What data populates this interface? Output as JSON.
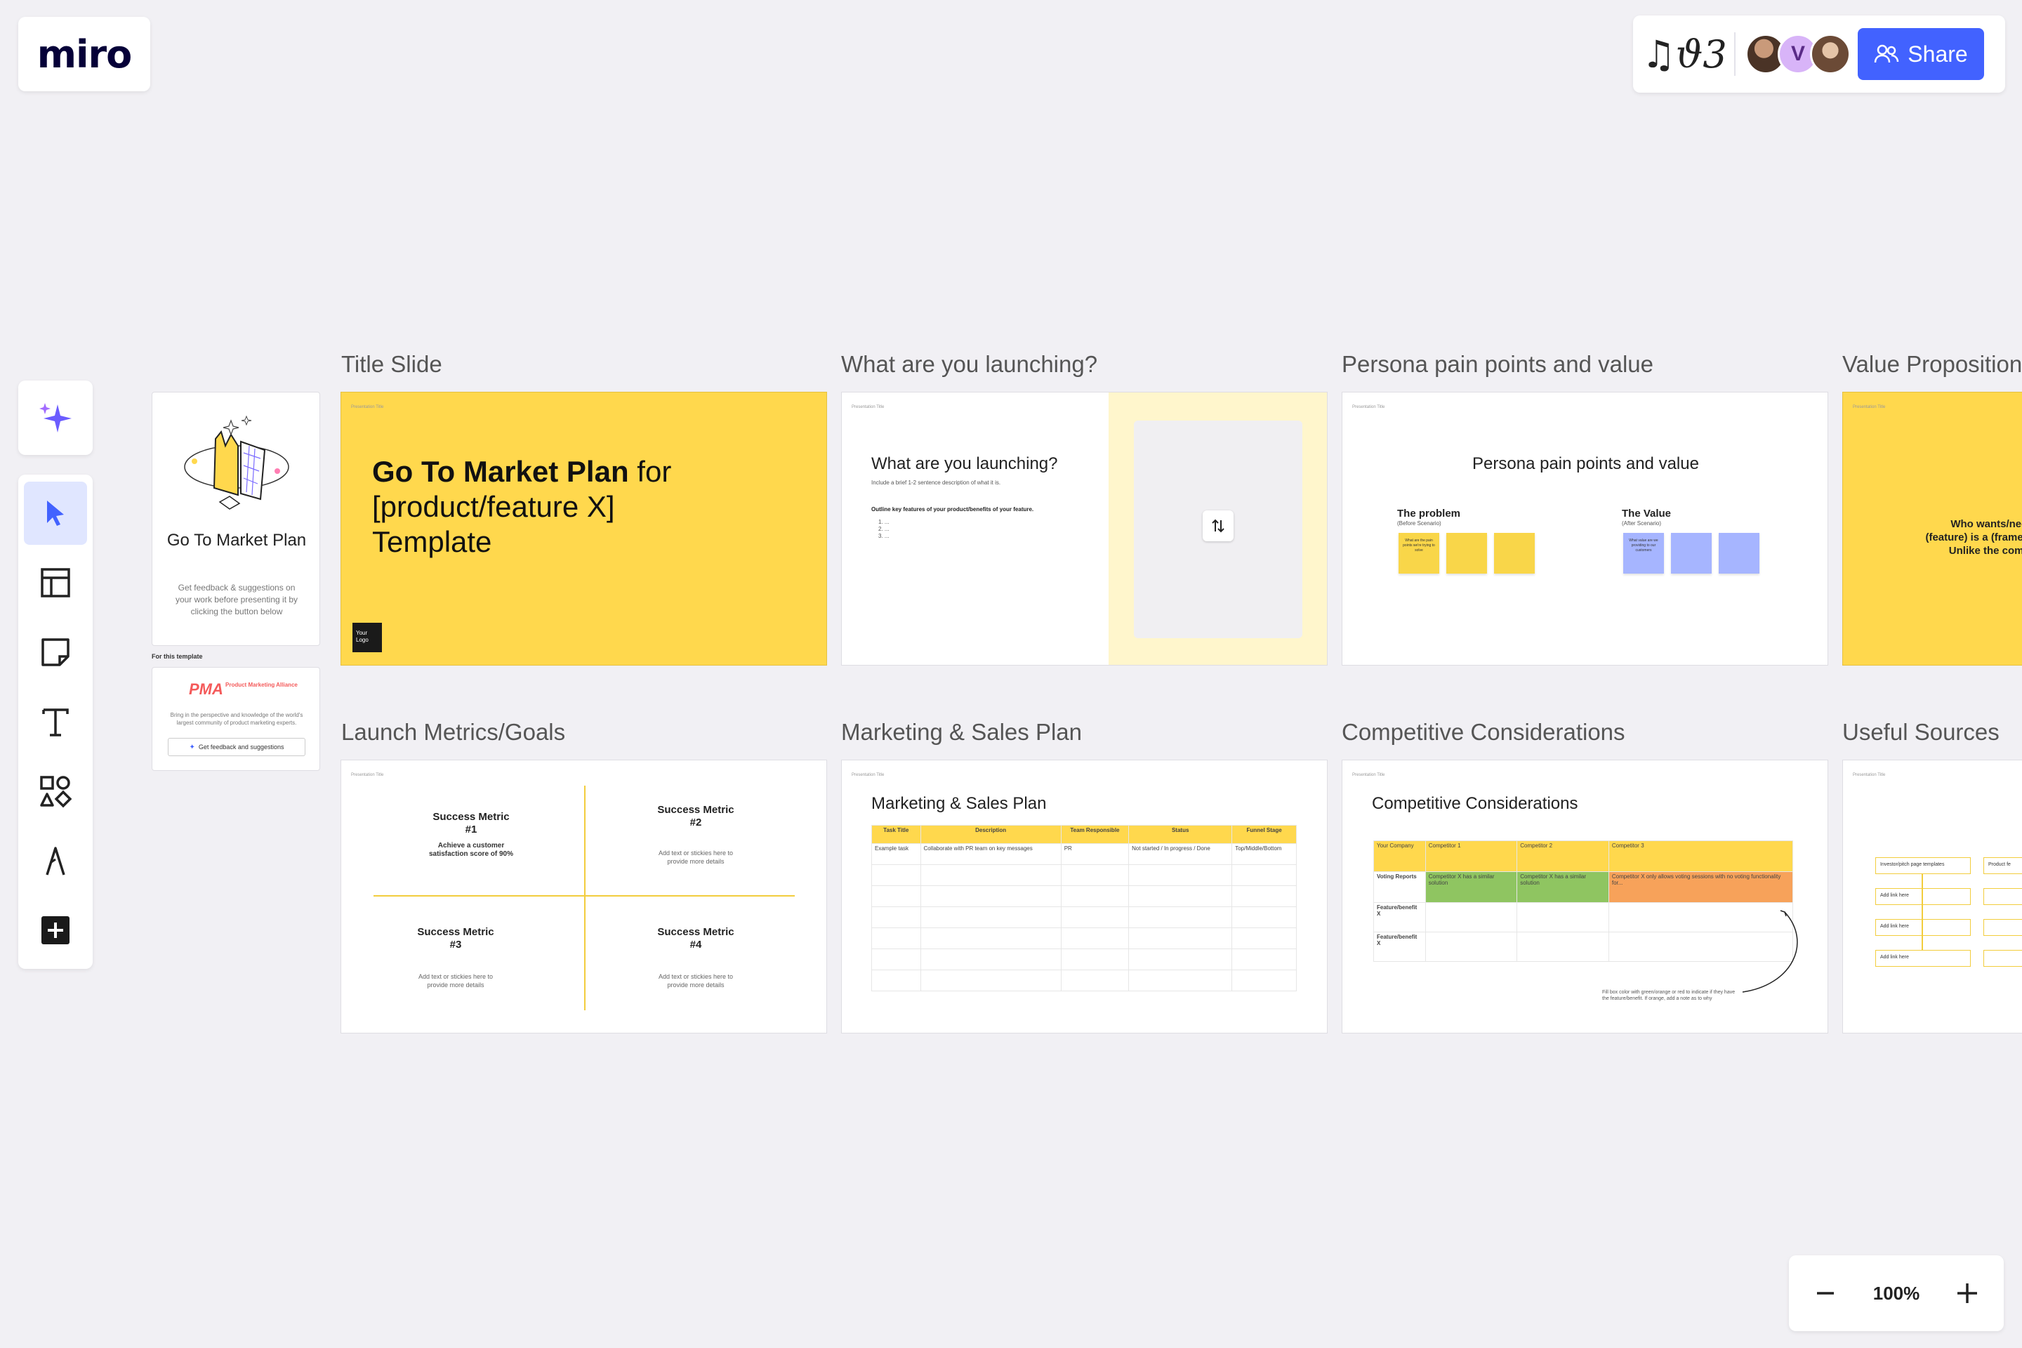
{
  "brand": {
    "logo_text": "miro"
  },
  "header": {
    "reactions_text": "♫ϑ3",
    "avatar_initial": "V",
    "share_label": "Share"
  },
  "zoom": {
    "level": "100%"
  },
  "template_panel": {
    "title": "Go To Market Plan",
    "description": "Get feedback & suggestions on your work before presenting it by clicking the button below",
    "for_this_template": "For this template",
    "pma_logo": "PMA",
    "pma_name": "Product Marketing Alliance",
    "pma_text": "Bring in the perspective and knowledge of the world's largest community of product marketing experts.",
    "feedback_button": "Get feedback and suggestions"
  },
  "frames": [
    {
      "label": "Title Slide"
    },
    {
      "label": "What are you launching?"
    },
    {
      "label": "Persona pain points and value"
    },
    {
      "label": "Value Proposition"
    },
    {
      "label": "Launch Metrics/Goals"
    },
    {
      "label": "Marketing & Sales Plan"
    },
    {
      "label": "Competitive Considerations"
    },
    {
      "label": "Useful Sources"
    }
  ],
  "title_slide": {
    "presentation_title": "Presentation Title",
    "heading_bold": "Go To Market Plan",
    "heading_rest": " for [product/feature X] Template",
    "logo_text": "Your Logo"
  },
  "launching": {
    "heading": "What are you launching?",
    "sub": "Include a brief 1-2 sentence description of what it is.",
    "outline": "Outline key features of your product/benefits of your feature.",
    "items": [
      "1. ...",
      "2. ...",
      "3. ..."
    ]
  },
  "persona": {
    "heading": "Persona pain points and value",
    "problem": "The problem",
    "problem_sub": "(Before Scenario)",
    "value": "The Value",
    "value_sub": "(After Scenario)",
    "sticky_problem_text": "What are the pain points we're trying to solve",
    "sticky_value_text": "What value are we providing to our customers"
  },
  "value_prop": {
    "text": "Who wants/needs (feature) is a (frame of) Unlike the compet"
  },
  "metrics": {
    "m1_title": "Success Metric #1",
    "m1_body": "Achieve a customer satisfaction score of 90%",
    "m2_title": "Success Metric #2",
    "m3_title": "Success Metric #3",
    "m4_title": "Success Metric #4",
    "placeholder": "Add text or stickies here to provide more details"
  },
  "marketing": {
    "heading": "Marketing & Sales Plan",
    "columns": [
      "Task Title",
      "Description",
      "Team Responsible",
      "Status",
      "Funnel Stage"
    ],
    "row1": [
      "Example task",
      "Collaborate with PR team on key messages",
      "PR",
      "Not started / In progress / Done",
      "Top/Middle/Bottom"
    ]
  },
  "competitive": {
    "heading": "Competitive Considerations",
    "columns": [
      "Your Company",
      "Competitor 1",
      "Competitor 2",
      "Competitor 3"
    ],
    "rows": [
      "Voting Reports",
      "Feature/benefit X",
      "Feature/benefit X"
    ],
    "cells": [
      "Competitor X has a similar solution",
      "Competitor X has a similar solution",
      "Competitor X only allows voting sessions with no voting functionality for..."
    ],
    "note": "Fill box color with green/orange or red to indicate if they have the feature/benefit. If orange, add a note as to why"
  },
  "sources": {
    "items": [
      "Investor/pitch page templates",
      "Add link here",
      "Add link here",
      "Add link here",
      "Product fe"
    ]
  },
  "colors": {
    "yellow": "#ffd84d",
    "accent": "#4262ff",
    "sticky_yellow": "#f9d649",
    "sticky_blue": "#a6b5ff",
    "green": "#8fc561",
    "orange": "#f7a25a"
  }
}
